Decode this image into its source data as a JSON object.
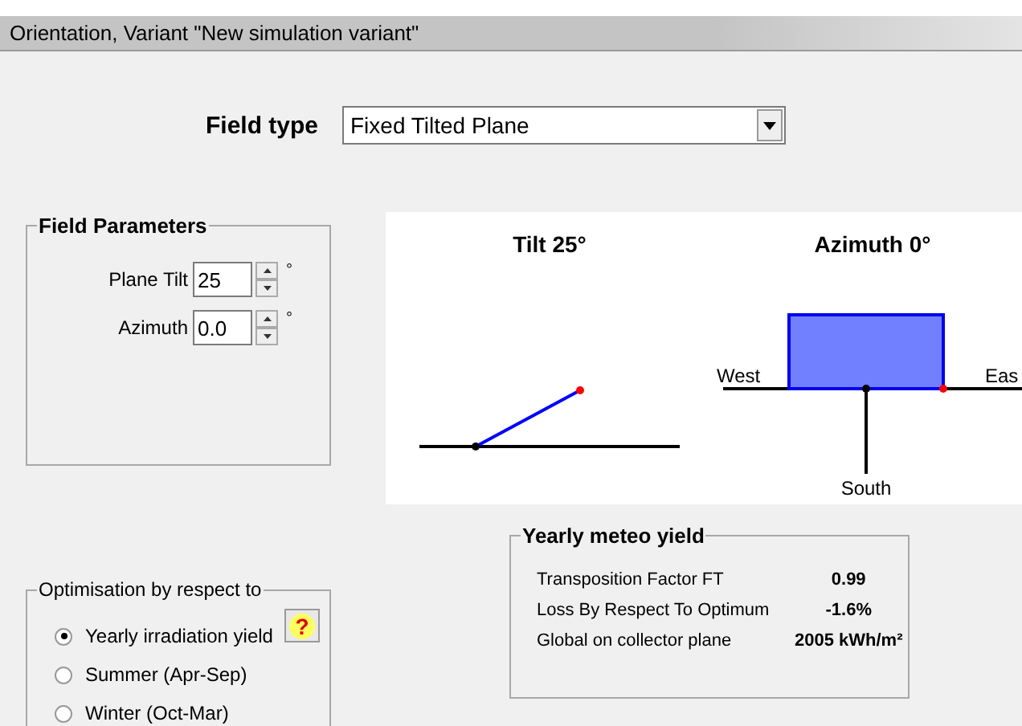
{
  "window": {
    "title": "Orientation, Variant \"New simulation variant\""
  },
  "field_type": {
    "label": "Field type",
    "value": "Fixed Tilted Plane"
  },
  "field_parameters": {
    "title": "Field Parameters",
    "fields": [
      {
        "label": "Plane Tilt",
        "value": "25",
        "unit": "°"
      },
      {
        "label": "Azimuth",
        "value": "0.0",
        "unit": "°"
      }
    ]
  },
  "diagram": {
    "tilt_title": "Tilt 25°",
    "azimuth_title": "Azimuth 0°",
    "west": "West",
    "east": "Eas",
    "south": "South"
  },
  "meteo_yield": {
    "title": "Yearly meteo yield",
    "rows": [
      {
        "label": "Transposition Factor FT",
        "value": "0.99"
      },
      {
        "label": "Loss By Respect To Optimum",
        "value": "-1.6%"
      },
      {
        "label": "Global on collector plane",
        "value": "2005 kWh/m²"
      }
    ]
  },
  "optimisation": {
    "title": "Optimisation by respect to",
    "help": "?",
    "options": [
      {
        "label": "Yearly irradiation yield",
        "selected": true
      },
      {
        "label": "Summer (Apr-Sep)",
        "selected": false
      },
      {
        "label": "Winter (Oct-Mar)",
        "selected": false
      }
    ]
  }
}
